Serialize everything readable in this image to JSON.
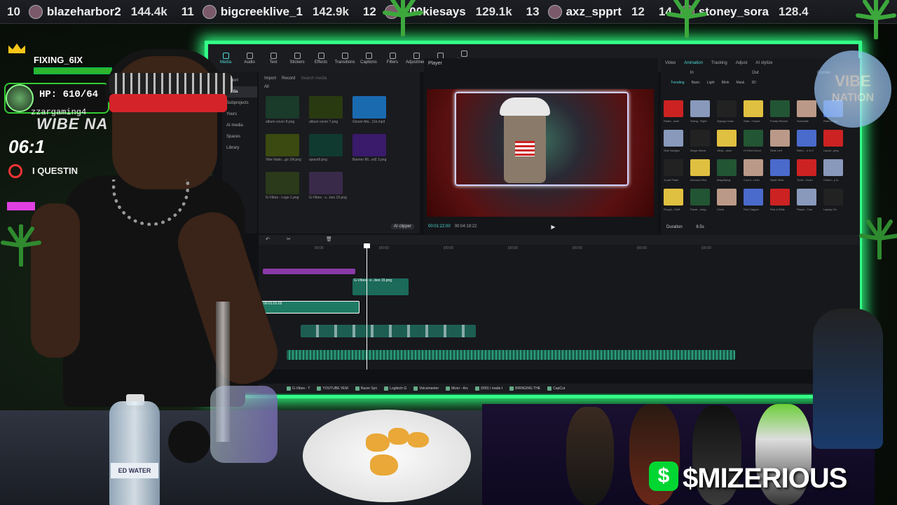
{
  "ticker": [
    {
      "rank": "10",
      "name": "blazeharbor2",
      "score": "144.4k"
    },
    {
      "rank": "11",
      "name": "bigcreeklive_1",
      "score": "142.9k"
    },
    {
      "rank": "12",
      "name": "c00kiesays",
      "score": "129.1k"
    },
    {
      "rank": "13",
      "name": "axz_spprt",
      "score": "12"
    },
    {
      "rank": "14",
      "name": "stoney_sora",
      "score": "128.4"
    }
  ],
  "overlay": {
    "player_name": "FIXING_6IX",
    "hp": "HP: 610/64",
    "username": "zzargaming4",
    "vibe": "WIBE NA",
    "time": "06:1",
    "quest": "I QUESTIN"
  },
  "editor": {
    "toolbar": [
      "Media",
      "Audio",
      "Text",
      "Stickers",
      "Effects",
      "Transitions",
      "Captions",
      "Filters",
      "Adjustment",
      "Templates",
      "AI avatar"
    ],
    "sidebar": [
      "Import",
      "Media",
      "Subprojects",
      "Yours",
      "AI media",
      "Spaces",
      "Library"
    ],
    "media_actions": {
      "import": "Import",
      "record": "Record",
      "search": "Search media"
    },
    "media_filter": "All",
    "media_items": [
      "album cover 8.png",
      "album cover 7.png",
      "Gloom-Ma...11k.mp3",
      "Vibe Natio...go 1M.png",
      "space8.png",
      "Banner 86...ed) 3.png",
      "G-Vibes - Logo 1.png",
      "G-Vibes - s...bes 15.png"
    ],
    "ai_clip": "AI clipper",
    "player": {
      "title": "Player",
      "current": "00:01:22:00",
      "total": "00:04:19:22"
    },
    "props_tabs": [
      "Video",
      "Animation",
      "Tracking",
      "Adjust",
      "AI stylize"
    ],
    "props_subtabs": [
      "In",
      "Out",
      "Combo"
    ],
    "anim_tabs": [
      "Trending",
      "Basic",
      "Light",
      "Blink",
      "Mask",
      "3D"
    ],
    "anim_items": [
      "Radia...ortal",
      "Swing...Right",
      "Zigzag Crack",
      "Start...t Issue",
      "Frosty Reveal",
      "Sunnable",
      "Retro Flash",
      "Side Nudges",
      "Magic Wand",
      "Vibra...ance",
      "Hi Field Zoom",
      "Slide Left",
      "Retro ...e in 2",
      "Liquid...ping",
      "3-part Flash",
      "Inbound Dive",
      "Magnifying",
      "Count...t Itch",
      "Spirit Glide",
      "Turnt...Zoom",
      "Cinem...y In",
      "Rough...Shift",
      "Panel...rning",
      "Circle",
      "Roll Clapper",
      "Pick A Slide",
      "Player...Turn",
      "Laptop On"
    ],
    "duration_label": "Duration",
    "duration_value": "8.5s",
    "ruler": [
      "00:00",
      "|00:00",
      "|00:00",
      "|00:00",
      "|00:00",
      "|00:00",
      "|00:00"
    ],
    "clips": {
      "overlay": "G-Vibes - e...bes 15.png",
      "main": "00:01:01:02"
    },
    "taskbar": [
      "G-Vibes - T",
      "YOUTUBE VEM",
      "Razer Syn",
      "Logitech G",
      "Voicemeeter",
      "Mizer - Arc",
      "(000) I made t",
      "BRINGING THE",
      "CapCut"
    ]
  },
  "vibe_logo": [
    "VIBE",
    "NATION"
  ],
  "sponsor": {
    "cashtag_icon": "$",
    "name": "$MIZERIOUS"
  },
  "bottle_label": "ED WATER",
  "colors": {
    "neon": "#33ff88",
    "accent": "#4fd8d8",
    "cash": "#00d632",
    "band": "#d4242a"
  }
}
